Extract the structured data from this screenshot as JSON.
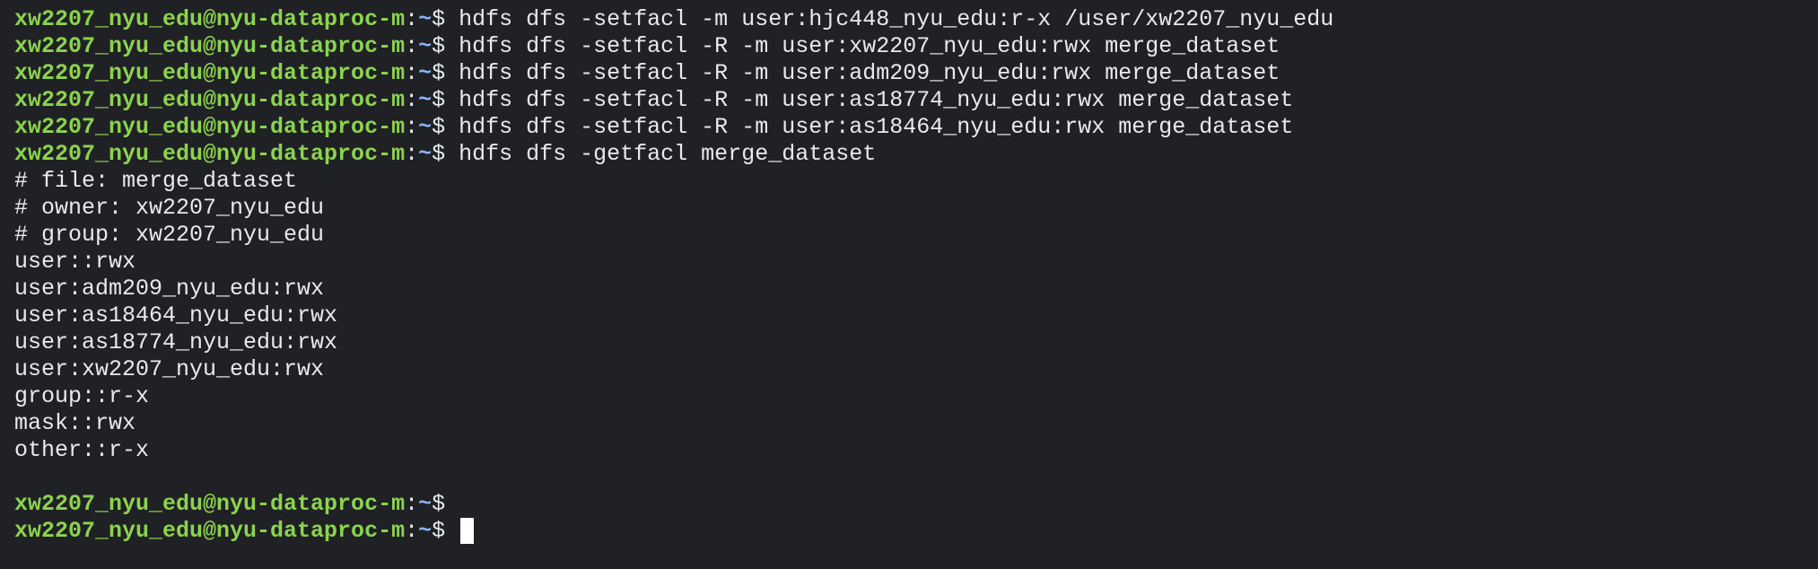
{
  "terminal": {
    "prompt": {
      "user_host": "xw2207_nyu_edu@nyu-dataproc-m",
      "separator": ":",
      "path": "~",
      "symbol": "$"
    },
    "lines": [
      {
        "type": "command",
        "text": "hdfs dfs -setfacl -m user:hjc448_nyu_edu:r-x /user/xw2207_nyu_edu"
      },
      {
        "type": "command",
        "text": "hdfs dfs -setfacl -R -m user:xw2207_nyu_edu:rwx merge_dataset"
      },
      {
        "type": "command",
        "text": "hdfs dfs -setfacl -R -m user:adm209_nyu_edu:rwx merge_dataset"
      },
      {
        "type": "command",
        "text": "hdfs dfs -setfacl -R -m user:as18774_nyu_edu:rwx merge_dataset"
      },
      {
        "type": "command",
        "text": "hdfs dfs -setfacl -R -m user:as18464_nyu_edu:rwx merge_dataset"
      },
      {
        "type": "command",
        "text": "hdfs dfs -getfacl merge_dataset"
      },
      {
        "type": "output",
        "text": "# file: merge_dataset"
      },
      {
        "type": "output",
        "text": "# owner: xw2207_nyu_edu"
      },
      {
        "type": "output",
        "text": "# group: xw2207_nyu_edu"
      },
      {
        "type": "output",
        "text": "user::rwx"
      },
      {
        "type": "output",
        "text": "user:adm209_nyu_edu:rwx"
      },
      {
        "type": "output",
        "text": "user:as18464_nyu_edu:rwx"
      },
      {
        "type": "output",
        "text": "user:as18774_nyu_edu:rwx"
      },
      {
        "type": "output",
        "text": "user:xw2207_nyu_edu:rwx"
      },
      {
        "type": "output",
        "text": "group::r-x"
      },
      {
        "type": "output",
        "text": "mask::rwx"
      },
      {
        "type": "output",
        "text": "other::r-x"
      },
      {
        "type": "output",
        "text": ""
      },
      {
        "type": "command",
        "text": ""
      },
      {
        "type": "active",
        "text": ""
      }
    ],
    "colors": {
      "background": "#202124",
      "foreground": "#e8eaed",
      "prompt_user": "#8bd34e",
      "prompt_path": "#8ab4f8",
      "cursor": "#ffffff"
    }
  }
}
